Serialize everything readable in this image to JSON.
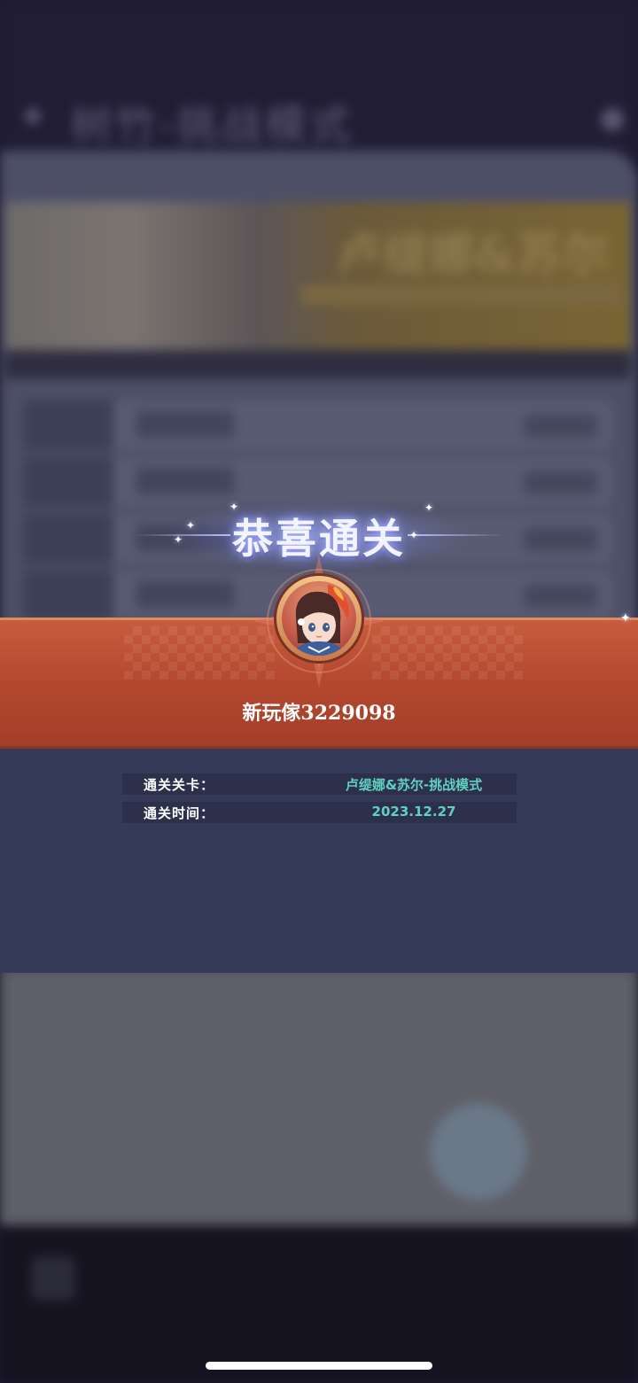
{
  "background": {
    "header_title": "树竹-挑战模式",
    "banner_title": "卢缇娜&苏尔"
  },
  "result": {
    "title": "恭喜通关",
    "player_name": "新玩傢3229098",
    "info": [
      {
        "label": "通关关卡：",
        "value": "卢缇娜&苏尔-挑战模式"
      },
      {
        "label": "通关时间：",
        "value": "2023.12.27"
      }
    ]
  },
  "colors": {
    "ribbon": "#b4482f",
    "panel": "#353a58",
    "value_text": "#5fd0c2"
  }
}
